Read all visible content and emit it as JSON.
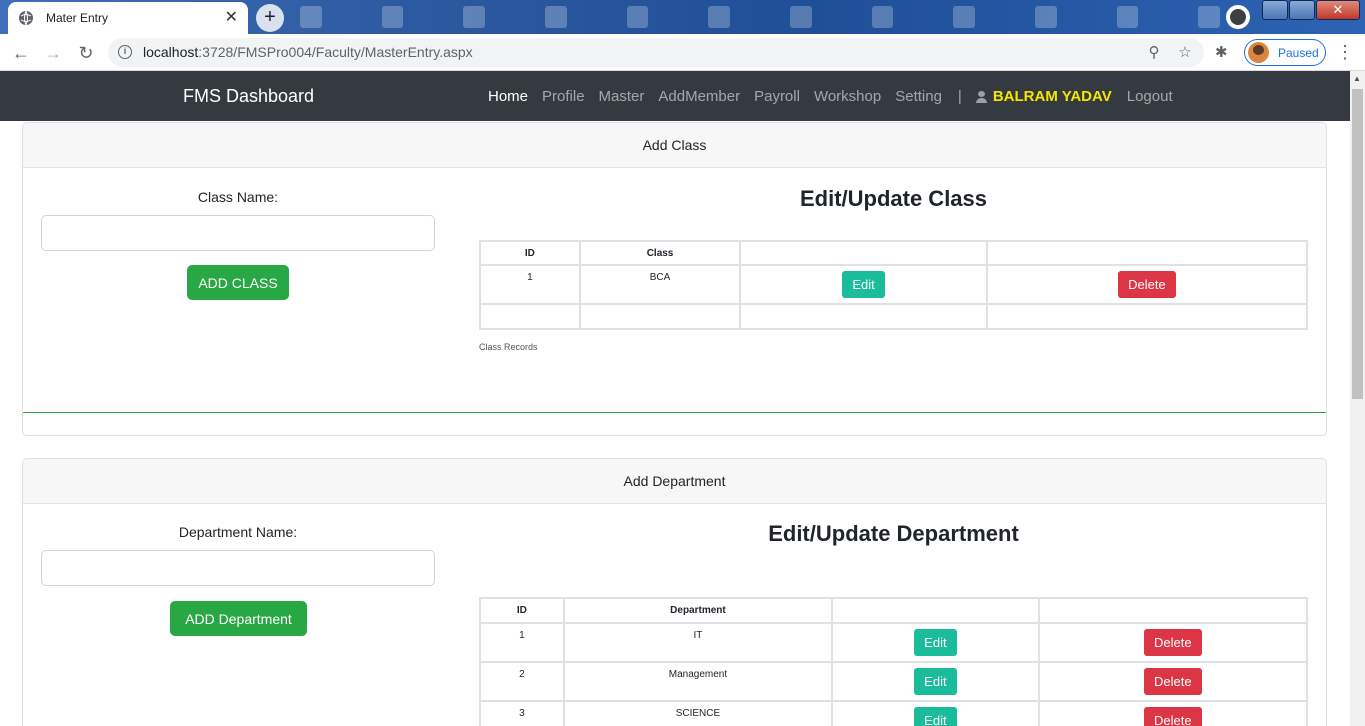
{
  "browser": {
    "tab_title": "Mater Entry",
    "url_host": "localhost",
    "url_rest": ":3728/FMSPro004/Faculty/MasterEntry.aspx",
    "profile_status": "Paused"
  },
  "navbar": {
    "brand": "FMS Dashboard",
    "links": [
      "Home",
      "Profile",
      "Master",
      "AddMember",
      "Payroll",
      "Workshop",
      "Setting"
    ],
    "separator": "|",
    "user_name": "BALRAM YADAV",
    "logout": "Logout"
  },
  "class_section": {
    "header": "Add Class",
    "field_label": "Class Name:",
    "field_value": "",
    "add_button": "ADD CLASS",
    "table_title": "Edit/Update Class",
    "columns": [
      "ID",
      "Class",
      "",
      ""
    ],
    "rows": [
      {
        "id": "1",
        "name": "BCA",
        "edit": "Edit",
        "delete": "Delete"
      }
    ],
    "caption": "Class Records"
  },
  "department_section": {
    "header": "Add Department",
    "field_label": "Department Name:",
    "field_value": "",
    "add_button": "ADD Department",
    "table_title": "Edit/Update Department",
    "columns": [
      "ID",
      "Department",
      "",
      ""
    ],
    "rows": [
      {
        "id": "1",
        "name": "IT",
        "edit": "Edit",
        "delete": "Delete"
      },
      {
        "id": "2",
        "name": "Management",
        "edit": "Edit",
        "delete": "Delete"
      },
      {
        "id": "3",
        "name": "SCIENCE",
        "edit": "Edit",
        "delete": "Delete"
      }
    ]
  },
  "colors": {
    "navbar_bg": "#343a40",
    "user_name": "#f7e600",
    "add_button": "#28a745",
    "edit_button": "#1abc9c",
    "delete_button": "#dc3545"
  }
}
